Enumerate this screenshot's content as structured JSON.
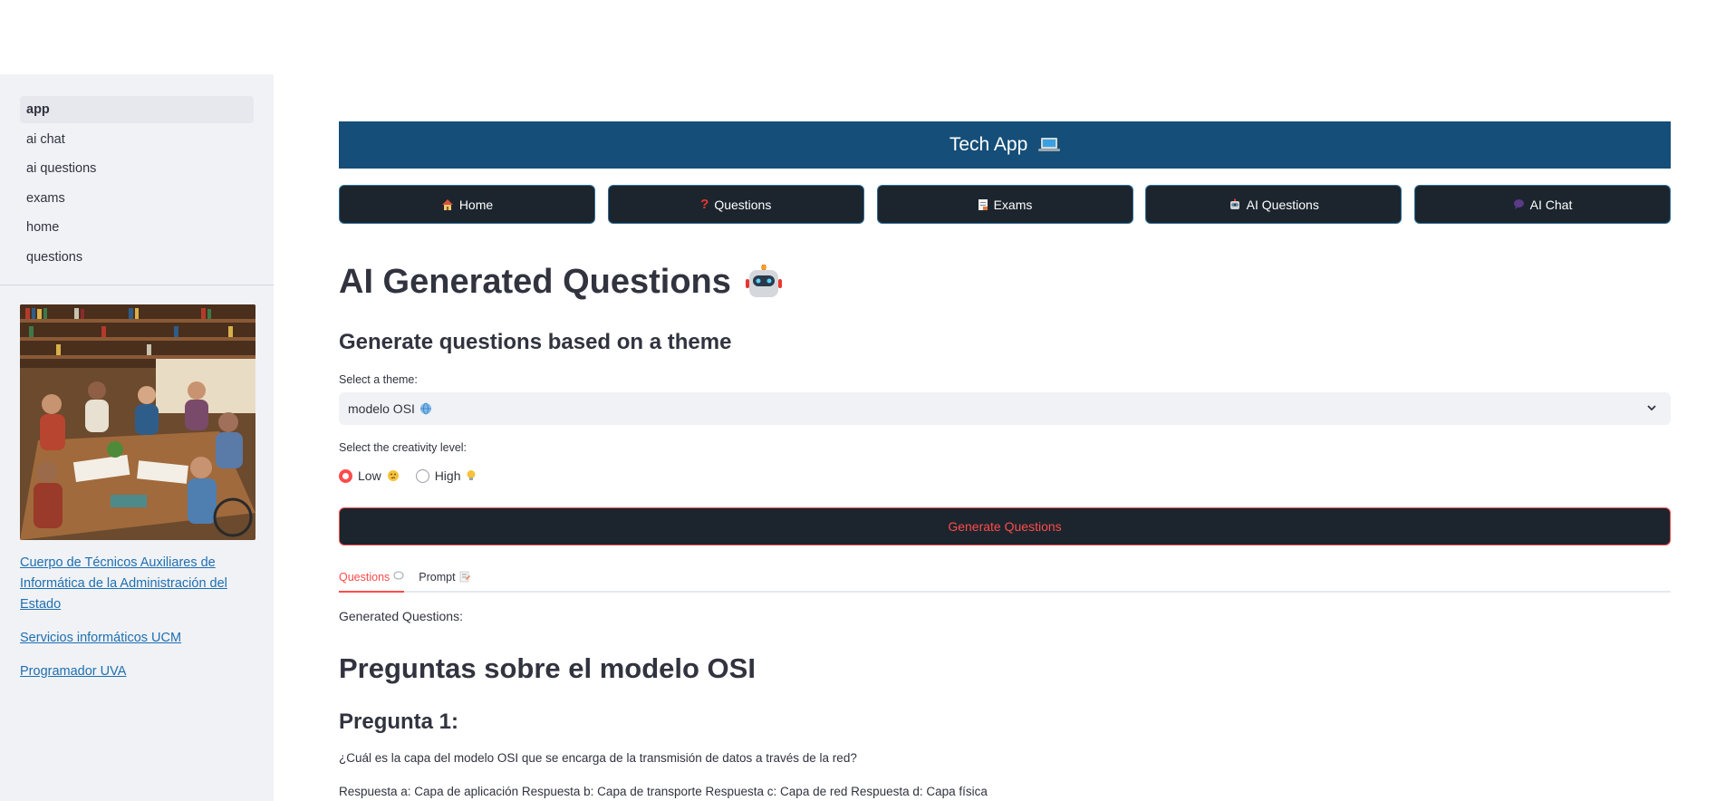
{
  "sidebar": {
    "items": [
      {
        "label": "app",
        "active": true
      },
      {
        "label": "ai chat"
      },
      {
        "label": "ai questions"
      },
      {
        "label": "exams"
      },
      {
        "label": "home"
      },
      {
        "label": "questions"
      }
    ],
    "links": [
      "Cuerpo de Técnicos Auxiliares de Informática de la Administración del Estado",
      "Servicios informáticos UCM",
      "Programador UVA"
    ]
  },
  "header": {
    "banner_title": "Tech App"
  },
  "nav_buttons": [
    {
      "label": "Home",
      "icon": "house-icon"
    },
    {
      "label": "Questions",
      "icon": "question-mark-icon"
    },
    {
      "label": "Exams",
      "icon": "document-icon"
    },
    {
      "label": "AI Questions",
      "icon": "robot-icon"
    },
    {
      "label": "AI Chat",
      "icon": "speech-bubble-icon"
    }
  ],
  "main": {
    "title": "AI Generated Questions",
    "subtitle": "Generate questions based on a theme",
    "theme_label": "Select a theme:",
    "theme_value": "modelo OSI",
    "creativity_label": "Select the creativity level:",
    "creativity_options": [
      "Low",
      "High"
    ],
    "creativity_selected": "Low",
    "generate_button": "Generate Questions",
    "tabs": [
      "Questions",
      "Prompt"
    ],
    "generated_label": "Generated Questions:",
    "result_heading": "Preguntas sobre el modelo OSI",
    "question_heading": "Pregunta 1:",
    "question_text": "¿Cuál es la capa del modelo OSI que se encarga de la transmisión de datos a través de la red?",
    "answers_text": "Respuesta a: Capa de aplicación Respuesta b: Capa de transporte Respuesta c: Capa de red Respuesta d: Capa física"
  },
  "colors": {
    "banner": "#154e78",
    "button_dark": "#1c252d",
    "accent_red": "#ff4b4b",
    "sidebar_bg": "#f0f2f6",
    "link": "#1f6fb0"
  }
}
